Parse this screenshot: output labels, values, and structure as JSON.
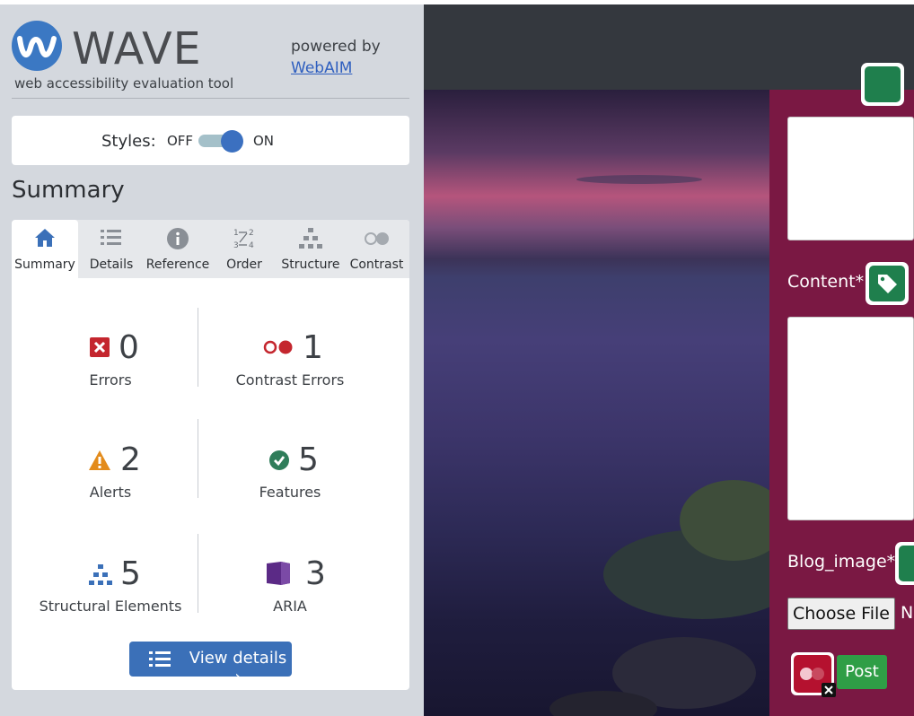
{
  "wave": {
    "title": "WAVE",
    "tagline": "web accessibility evaluation tool",
    "powered_by": "powered by",
    "webaim_link": "WebAIM"
  },
  "styles_toggle": {
    "label": "Styles:",
    "off": "OFF",
    "on": "ON",
    "state": "on"
  },
  "summary": {
    "heading": "Summary",
    "tabs": [
      {
        "label": "Summary",
        "icon": "home-icon",
        "active": true
      },
      {
        "label": "Details",
        "icon": "list-icon",
        "active": false
      },
      {
        "label": "Reference",
        "icon": "info-icon",
        "active": false
      },
      {
        "label": "Order",
        "icon": "order-icon",
        "active": false
      },
      {
        "label": "Structure",
        "icon": "structure-icon",
        "active": false
      },
      {
        "label": "Contrast",
        "icon": "contrast-icon",
        "active": false
      }
    ],
    "stats": {
      "errors": {
        "count": "0",
        "label": "Errors"
      },
      "contrast_errors": {
        "count": "1",
        "label": "Contrast Errors"
      },
      "alerts": {
        "count": "2",
        "label": "Alerts"
      },
      "features": {
        "count": "5",
        "label": "Features"
      },
      "structural": {
        "count": "5",
        "label": "Structural Elements"
      },
      "aria": {
        "count": "3",
        "label": "ARIA"
      }
    },
    "view_details": "View details ›"
  },
  "page_form": {
    "content_label": "Content*",
    "blog_image_label": "Blog_image*",
    "choose_file": "Choose File",
    "no_file": "N",
    "post": "Post"
  },
  "colors": {
    "accent_blue": "#3b70b8",
    "error_red": "#c4262e",
    "alert_orange": "#e38b1b",
    "feature_green": "#2f7d5a",
    "aria_purple": "#5b2a86",
    "form_panel": "#7a1843"
  }
}
